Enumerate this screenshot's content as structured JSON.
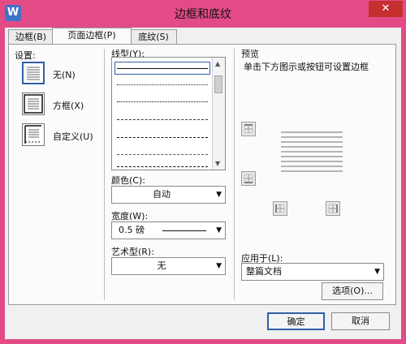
{
  "window": {
    "title": "边框和底纹",
    "app_icon": "W",
    "close_glyph": "✕"
  },
  "tabs": [
    {
      "label": "边框(B)"
    },
    {
      "label": "页面边框(P)"
    },
    {
      "label": "底纹(S)"
    }
  ],
  "settings": {
    "header": "设置:",
    "options": [
      {
        "label": "无(N)",
        "icon": "none-icon"
      },
      {
        "label": "方框(X)",
        "icon": "box-icon"
      },
      {
        "label": "自定义(U)",
        "icon": "custom-icon"
      }
    ]
  },
  "line_style": {
    "header": "线型(Y):",
    "styles": [
      "solid",
      "dotted-fine",
      "dotted",
      "dashed-short",
      "dashed",
      "dash-dot",
      "dash-dot-long"
    ]
  },
  "color": {
    "label": "颜色(C):",
    "value": "自动"
  },
  "width": {
    "label": "宽度(W):",
    "value": "0.5 磅"
  },
  "art": {
    "label": "艺术型(R):",
    "value": "无"
  },
  "preview": {
    "header": "预览",
    "hint": "单击下方图示或按钮可设置边框"
  },
  "apply_to": {
    "label": "应用于(L):",
    "value": "整篇文档"
  },
  "buttons": {
    "options": "选项(O)...",
    "ok": "确定",
    "cancel": "取消"
  },
  "colors": {
    "titlebar": "#e34b87",
    "close": "#c62f2f",
    "accent": "#2f5fa8"
  }
}
